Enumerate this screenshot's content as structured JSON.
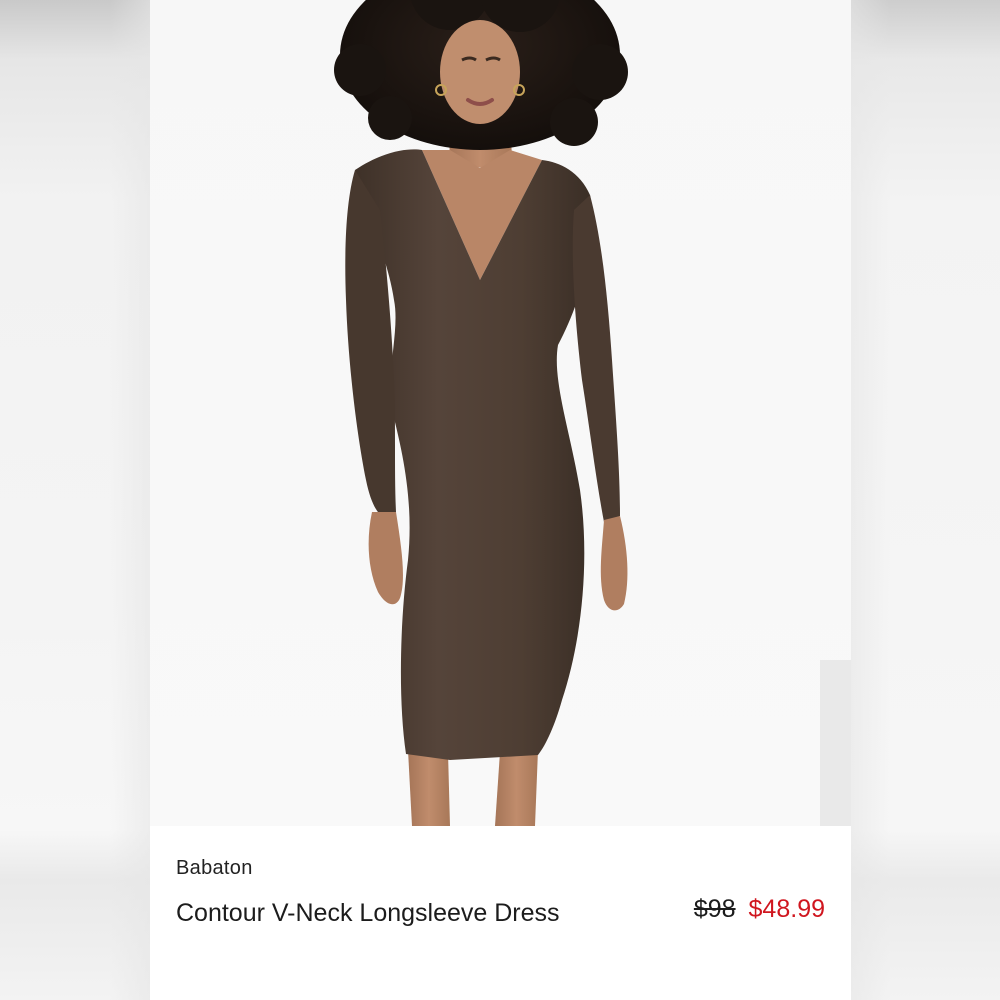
{
  "product": {
    "brand": "Babaton",
    "title": "Contour V-Neck Longsleeve Dress",
    "price_original": "$98",
    "price_sale": "$48.99",
    "image_alt": "model-wearing-brown-v-neck-longsleeve-midi-dress"
  },
  "colors": {
    "dress": "#4e3e33",
    "sale_price": "#d0161f",
    "text": "#1c1c1c"
  }
}
